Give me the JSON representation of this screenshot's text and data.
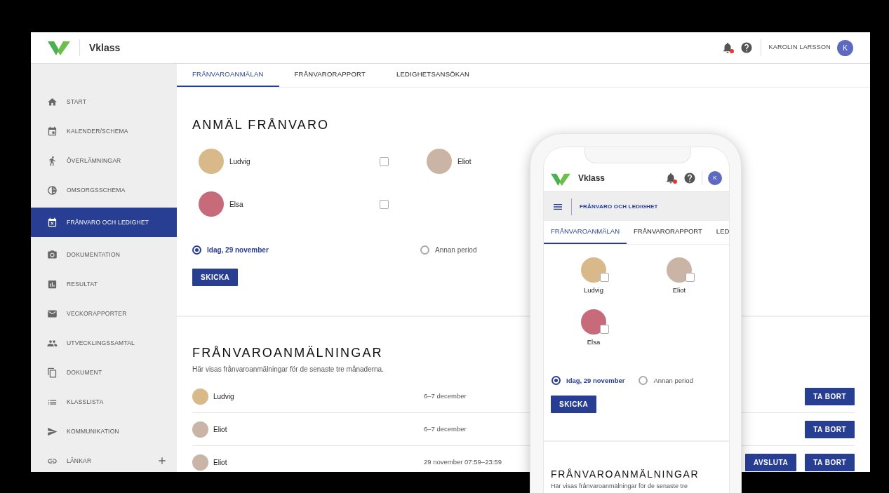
{
  "header": {
    "logo_text": "Vklass",
    "notification": true,
    "user_name": "KAROLIN LARSSON",
    "avatar_initial": "K"
  },
  "sidebar": {
    "items": [
      {
        "label": "START",
        "selected": false,
        "kind": "link"
      },
      {
        "label": "KALENDER/SCHEMA",
        "selected": false,
        "kind": "link"
      },
      {
        "label": "ÖVERLÄMNINGAR",
        "selected": false,
        "kind": "link"
      },
      {
        "label": "OMSORGSSCHEMA",
        "selected": false,
        "kind": "link"
      },
      {
        "label": "FRÅNVARO OCH LEDIGHET",
        "selected": true,
        "kind": "link"
      },
      {
        "label": "DOKUMENTATION",
        "selected": false,
        "kind": "link"
      },
      {
        "label": "RESULTAT",
        "selected": false,
        "kind": "link"
      },
      {
        "label": "VECKORAPPORTER",
        "selected": false,
        "kind": "link"
      },
      {
        "label": "UTVECKLINGSSAMTAL",
        "selected": false,
        "kind": "link"
      },
      {
        "label": "DOKUMENT",
        "selected": false,
        "kind": "link"
      },
      {
        "label": "KLASSLISTA",
        "selected": false,
        "kind": "link"
      },
      {
        "label": "KOMMUNIKATION",
        "selected": false,
        "kind": "link"
      },
      {
        "label": "LÄNKAR",
        "selected": false,
        "kind": "group"
      }
    ]
  },
  "tabs": [
    {
      "label": "FRÅNVAROANMÄLAN",
      "selected": true
    },
    {
      "label": "FRÅNVARORAPPORT",
      "selected": false
    },
    {
      "label": "LEDIGHETSANSÖKAN",
      "selected": false
    }
  ],
  "form": {
    "title": "ANMÄL FRÅNVARO",
    "children": [
      {
        "name": "Ludvig",
        "checked": false
      },
      {
        "name": "Eliot"
      },
      {
        "name": "Elsa",
        "checked": false
      }
    ],
    "period_options": [
      {
        "label": "Idag, 29 november",
        "selected": true
      },
      {
        "label": "Annan period",
        "selected": false
      }
    ],
    "submit": "SKICKA"
  },
  "list": {
    "title": "FRÅNVAROANMÄLNINGAR",
    "subtitle": "Här visas frånvaroanmälningar för de senaste tre månaderna.",
    "rows": [
      {
        "name": "Ludvig",
        "date": "6–7 december",
        "actions": [
          "TA BORT"
        ]
      },
      {
        "name": "Eliot",
        "date": "6–7 december",
        "actions": [
          "TA BORT"
        ]
      },
      {
        "name": "Eliot",
        "date": "29 november 07:59–23:59",
        "actions": [
          "AVSLUTA",
          "TA BORT"
        ]
      }
    ]
  },
  "phone": {
    "header": {
      "logo_text": "Vklass",
      "notification": true,
      "avatar_initial": "K"
    },
    "breadcrumb": "FRÅNVARO OCH LEDIGHET",
    "tabs": [
      {
        "label": "FRÅNVAROANMÄLAN",
        "selected": true
      },
      {
        "label": "FRÅNVARORAPPORT",
        "selected": false
      },
      {
        "label": "LED",
        "selected": false
      }
    ],
    "children": [
      {
        "name": "Ludvig",
        "checked": false
      },
      {
        "name": "Eliot",
        "checked": false
      },
      {
        "name": "Elsa",
        "checked": false
      }
    ],
    "period_options": [
      {
        "label": "Idag, 29 november",
        "selected": true
      },
      {
        "label": "Annan period",
        "selected": false
      }
    ],
    "submit": "SKICKA",
    "list_title": "FRÅNVAROANMÄLNINGAR",
    "list_subtitle": "Här visas frånvaroanmälningar för de senaste tre"
  }
}
